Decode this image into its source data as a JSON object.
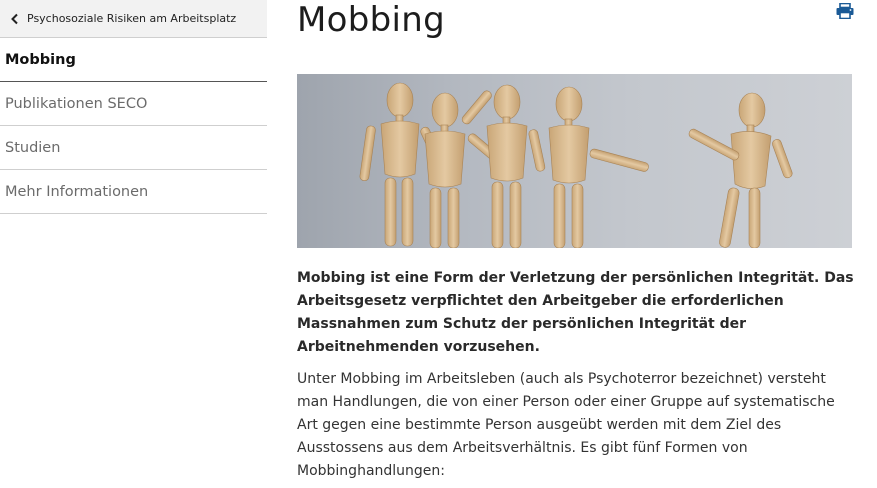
{
  "sidebar": {
    "back_label": "Psychosoziale Risiken am Arbeitsplatz",
    "items": [
      {
        "label": "Mobbing",
        "active": true
      },
      {
        "label": "Publikationen SECO",
        "active": false
      },
      {
        "label": "Studien",
        "active": false
      },
      {
        "label": "Mehr Informationen",
        "active": false
      }
    ]
  },
  "main": {
    "title": "Mobbing",
    "lead": "Mobbing ist eine Form der Verletzung der persönlichen Integrität. Das Arbeitsgesetz verpflichtet den Arbeitgeber die erforderlichen Massnahmen zum Schutz der persönlichen Integrität der Arbeitnehmenden vorzusehen.",
    "body": "Unter Mobbing im Arbeitsleben (auch als Psychoterror bezeichnet) versteht man Handlungen, die von einer Person oder einer Gruppe auf systematische Art gegen eine bestimmte Person ausgeübt werden mit dem Ziel des Ausstossens aus dem Arbeitsverhältnis. Es gibt fünf Formen von Mobbinghandlungen:"
  },
  "icons": {
    "back": "chevron-left-icon",
    "print": "print-icon"
  },
  "colors": {
    "print_icon": "#1a5a96",
    "wood": "#d9b98f"
  }
}
